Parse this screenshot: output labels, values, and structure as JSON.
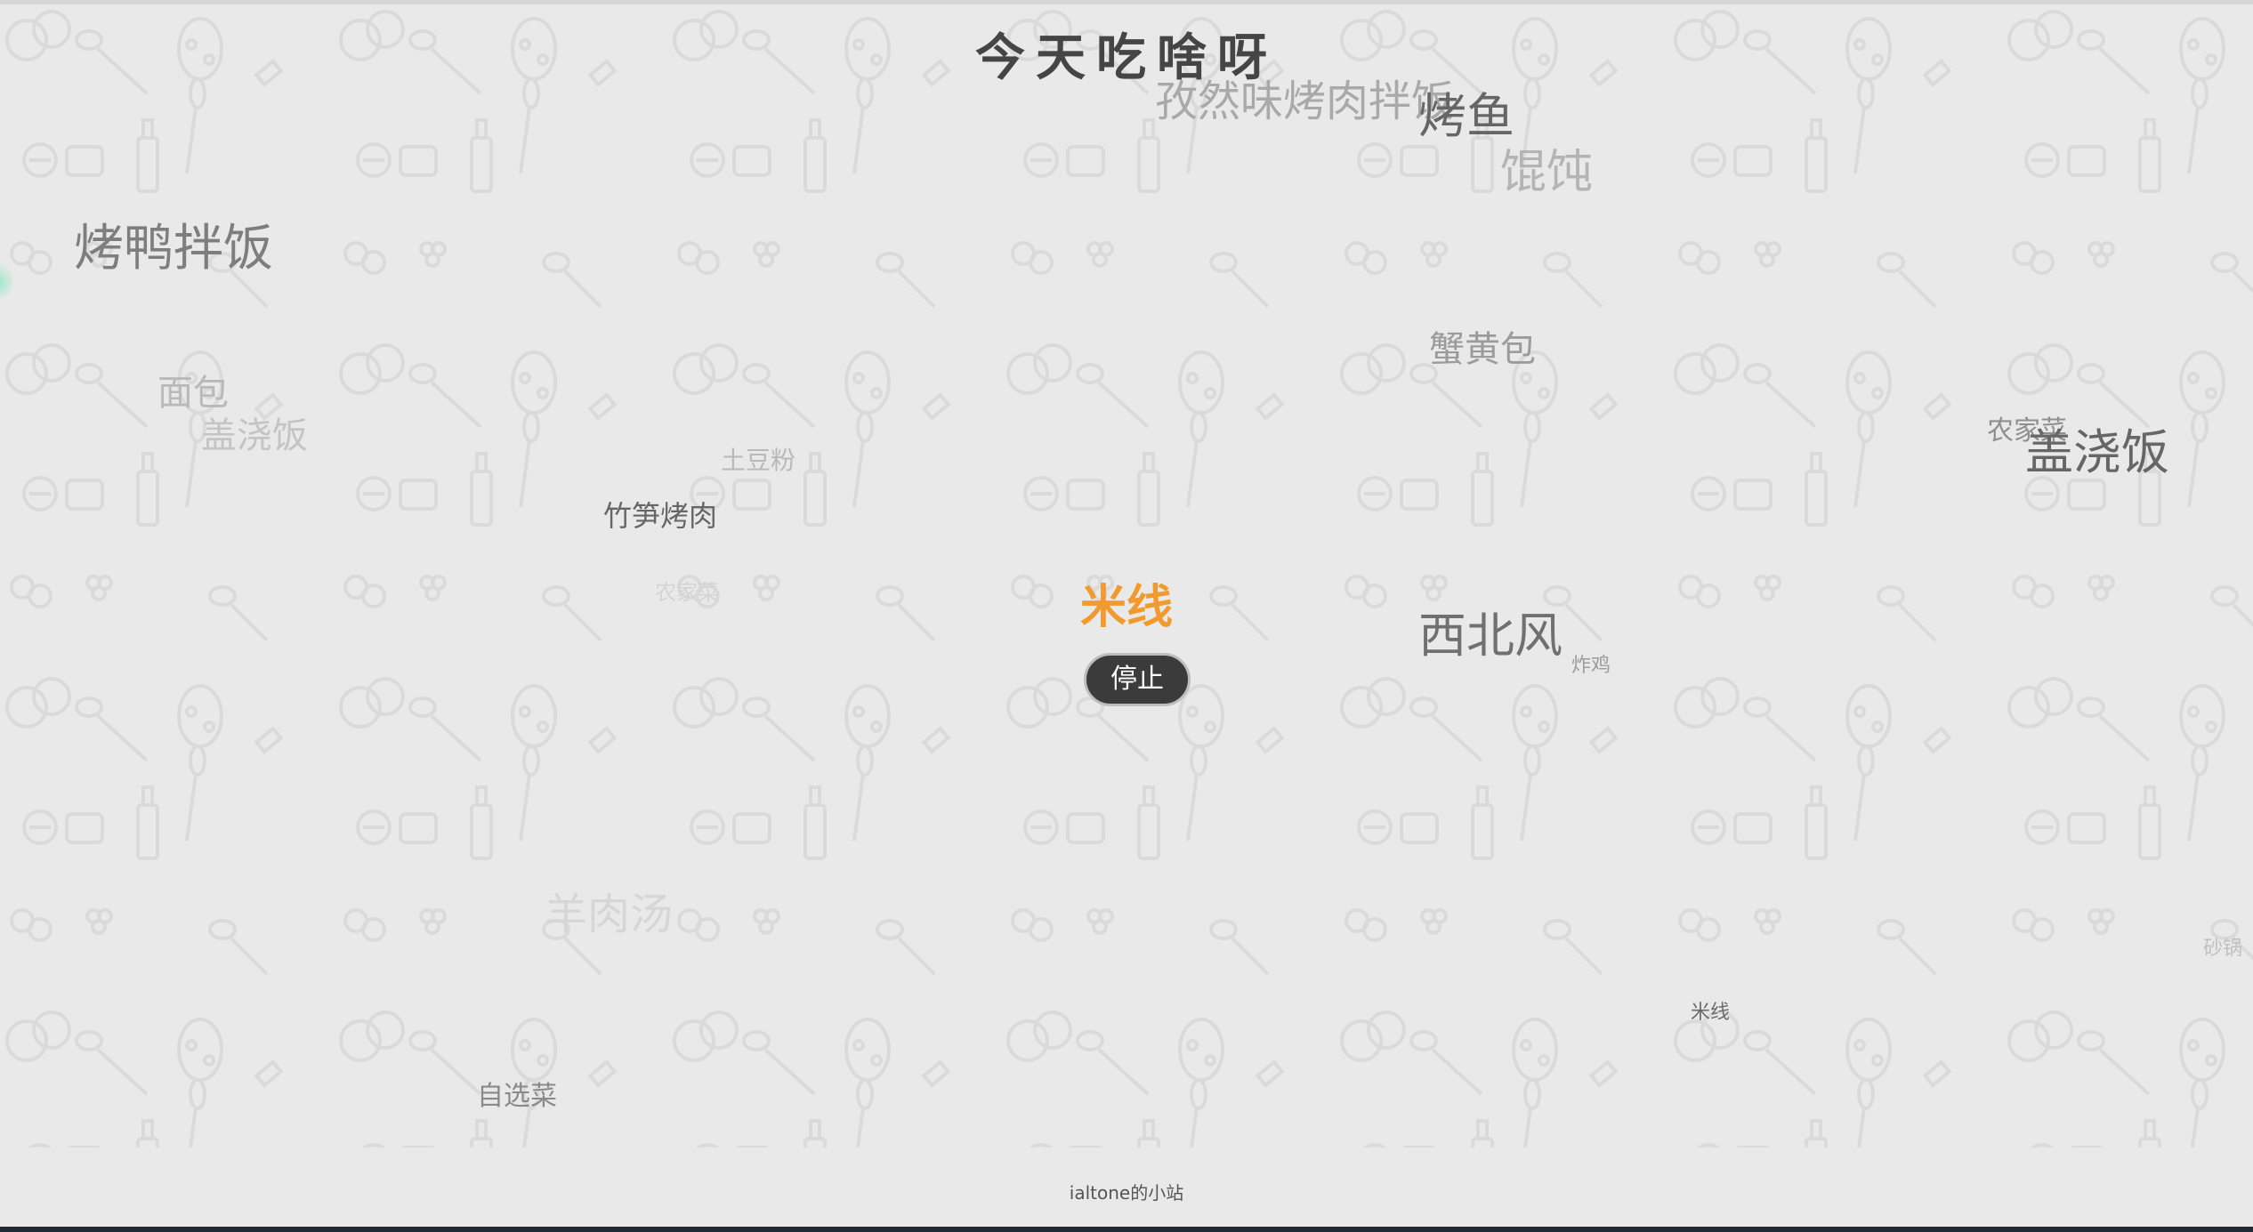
{
  "header": {
    "title": "今天吃啥呀"
  },
  "floating_foods": [
    {
      "label": "孜然味烤肉拌饭"
    },
    {
      "label": "烤鱼"
    },
    {
      "label": "馄饨"
    },
    {
      "label": "烤鸭拌饭"
    },
    {
      "label": "蟹黄包"
    },
    {
      "label": "面包"
    },
    {
      "label": "盖浇饭"
    },
    {
      "label": "土豆粉"
    },
    {
      "label": "竹笋烤肉"
    },
    {
      "label": "农家菜"
    },
    {
      "label": "盖浇饭"
    },
    {
      "label": "西北风"
    },
    {
      "label": "炸鸡"
    },
    {
      "label": "羊肉汤"
    },
    {
      "label": "砂锅"
    },
    {
      "label": "米线"
    },
    {
      "label": "自选菜"
    },
    {
      "label": "农家菜"
    }
  ],
  "result": {
    "value": "米线",
    "color": "#f39a2f"
  },
  "controls": {
    "stop_label": "停止"
  },
  "footer": {
    "link_text": "ialtone的小站"
  },
  "colors": {
    "background": "#e9e9e9",
    "button": "#3b3b3b",
    "accent": "#f39a2f"
  }
}
